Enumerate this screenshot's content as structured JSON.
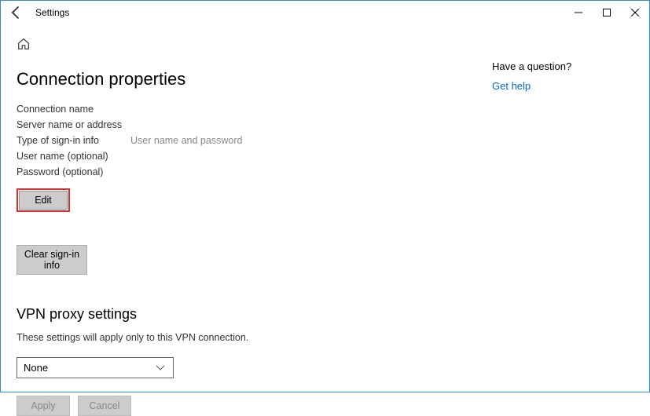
{
  "titlebar": {
    "title": "Settings"
  },
  "main": {
    "heading": "Connection properties",
    "props": {
      "conn_name_label": "Connection name",
      "server_label": "Server name or address",
      "signin_label": "Type of sign-in info",
      "signin_value": "User name and password",
      "user_label": "User name (optional)",
      "pass_label": "Password (optional)"
    },
    "edit_label": "Edit",
    "clear_label": "Clear sign-in info",
    "proxy_heading": "VPN proxy settings",
    "proxy_desc": "These settings will apply only to this VPN connection.",
    "proxy_value": "None",
    "apply_label": "Apply",
    "cancel_label": "Cancel"
  },
  "side": {
    "question": "Have a question?",
    "help": "Get help"
  }
}
